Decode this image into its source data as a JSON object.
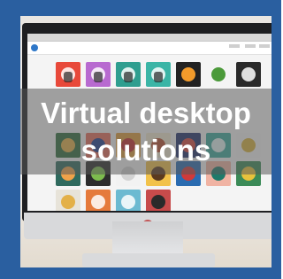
{
  "caption": {
    "line1": "Virtual desktop",
    "line2": "solutions"
  },
  "colors": {
    "frame": "#2a5fa0",
    "overlay": "rgba(90,90,90,0.55)",
    "caption_text": "#ffffff"
  }
}
